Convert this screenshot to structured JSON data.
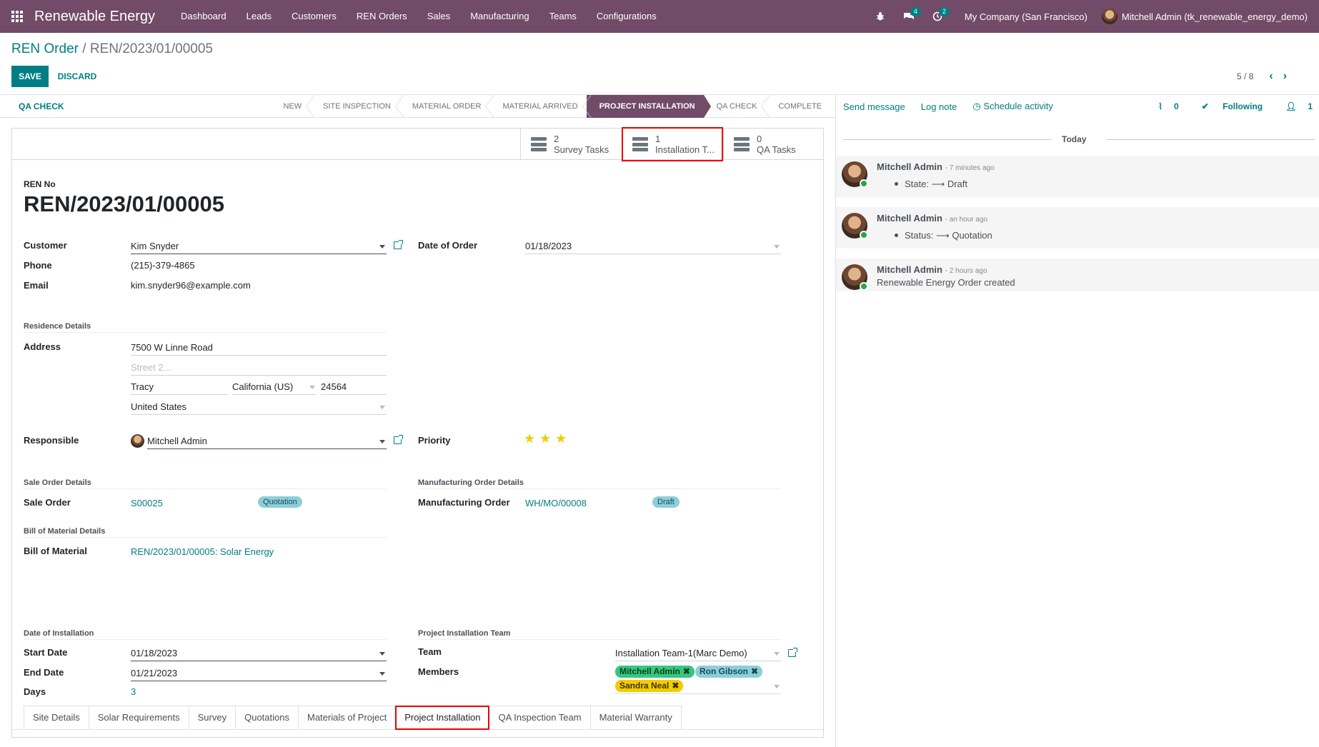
{
  "nav": {
    "brand": "Renewable Energy",
    "menu": [
      "Dashboard",
      "Leads",
      "Customers",
      "REN Orders",
      "Sales",
      "Manufacturing",
      "Teams",
      "Configurations"
    ],
    "messages_count": "4",
    "activities_count": "2",
    "company": "My Company (San Francisco)",
    "user": "Mitchell Admin (tk_renewable_energy_demo)"
  },
  "breadcrumb": {
    "parent": "REN Order",
    "separator": "/",
    "current": "REN/2023/01/00005"
  },
  "buttons": {
    "save": "SAVE",
    "discard": "DISCARD"
  },
  "pager": {
    "value": "5 / 8"
  },
  "statusbar": {
    "action": "QA CHECK",
    "stages": [
      "NEW",
      "SITE INSPECTION",
      "MATERIAL ORDER",
      "MATERIAL ARRIVED",
      "PROJECT INSTALLATION",
      "QA CHECK",
      "COMPLETE"
    ],
    "active_stage": "PROJECT INSTALLATION"
  },
  "smart_buttons": [
    {
      "count": "2",
      "label": "Survey Tasks"
    },
    {
      "count": "1",
      "label": "Installation T..."
    },
    {
      "count": "0",
      "label": "QA Tasks"
    }
  ],
  "form": {
    "ren_no_label": "REN No",
    "ren_no": "REN/2023/01/00005",
    "customer_label": "Customer",
    "customer": "Kim Snyder",
    "phone_label": "Phone",
    "phone": "(215)-379-4865",
    "email_label": "Email",
    "email": "kim.snyder96@example.com",
    "date_order_label": "Date of Order",
    "date_order": "01/18/2023",
    "residence_label": "Residence Details",
    "address_label": "Address",
    "street": "7500 W Linne Road",
    "street2_placeholder": "Street 2...",
    "city": "Tracy",
    "state": "California (US)",
    "zip": "24564",
    "country": "United States",
    "responsible_label": "Responsible",
    "responsible": "Mitchell Admin",
    "priority_label": "Priority",
    "priority_stars": 3,
    "sale_details_label": "Sale Order Details",
    "sale_order_label": "Sale Order",
    "sale_order": "S00025",
    "sale_status": "Quotation",
    "mo_details_label": "Manufacturing Order Details",
    "mo_label": "Manufacturing Order",
    "mo": "WH/MO/00008",
    "mo_status": "Draft",
    "bom_details_label": "Bill of Material Details",
    "bom_label": "Bill of Material",
    "bom": "REN/2023/01/00005: Solar Energy"
  },
  "tabs": [
    "Site Details",
    "Solar Requirements",
    "Survey",
    "Quotations",
    "Materials of Project",
    "Project Installation",
    "QA Inspection Team",
    "Material Warranty"
  ],
  "active_tab": "Project Installation",
  "installation": {
    "date_section": "Date of Installation",
    "start_label": "Start Date",
    "start": "01/18/2023",
    "end_label": "End Date",
    "end": "01/21/2023",
    "days_label": "Days",
    "days": "3",
    "team_section": "Project Installation Team",
    "team_label": "Team",
    "team": "Installation Team-1(Marc Demo)",
    "members_label": "Members",
    "members": [
      {
        "name": "Mitchell Admin",
        "color": "#36c77e"
      },
      {
        "name": "Ron Gibson",
        "color": "#8ccfdb"
      },
      {
        "name": "Sandra Neal",
        "color": "#f3cc00"
      }
    ]
  },
  "chatter": {
    "send_message": "Send message",
    "log_note": "Log note",
    "schedule": "Schedule activity",
    "attachments": "0",
    "following": "Following",
    "followers": "1",
    "today": "Today",
    "messages": [
      {
        "author": "Mitchell Admin",
        "when": "- 7 minutes ago",
        "body": "State: ⟶ Draft"
      },
      {
        "author": "Mitchell Admin",
        "when": "- an hour ago",
        "body": "Status: ⟶ Quotation"
      },
      {
        "author": "Mitchell Admin",
        "when": "- 2 hours ago",
        "body": "Renewable Energy Order created"
      }
    ]
  },
  "colors": {
    "brand": "#714B67",
    "accent": "#017e84",
    "highlight": "#ee0000"
  }
}
